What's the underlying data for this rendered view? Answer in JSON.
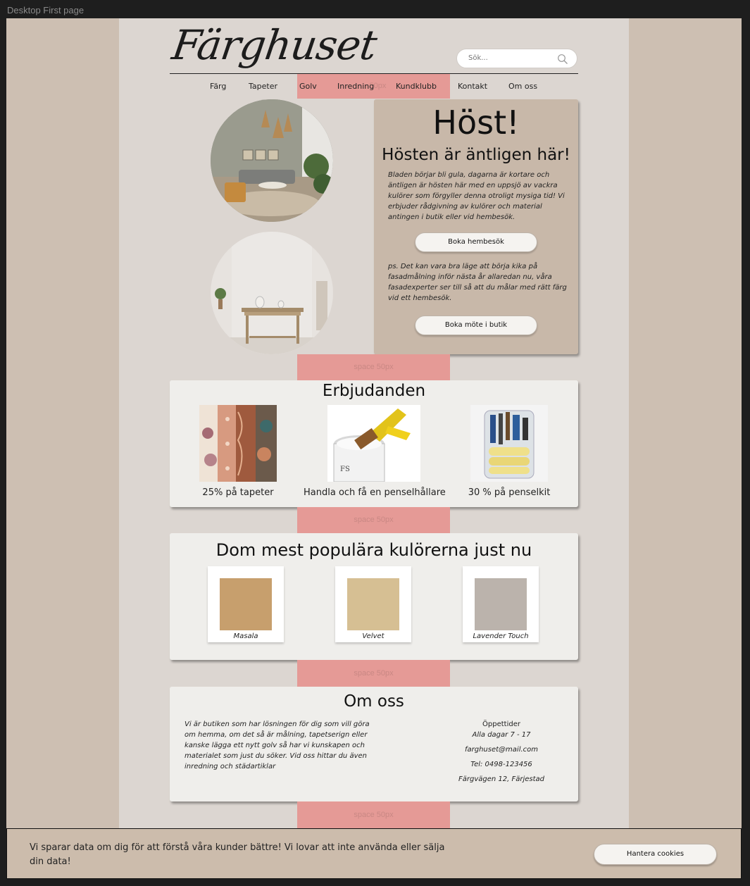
{
  "frame_label": "Desktop First page",
  "header": {
    "logo": "Färghuset",
    "search_placeholder": "Sök..."
  },
  "nav": {
    "items": [
      "Färg",
      "Tapeter",
      "Golv",
      "Inredning",
      "Kundklubb",
      "Kontakt",
      "Om oss"
    ],
    "spacer_label": "50px"
  },
  "hero": {
    "title": "Höst!",
    "subtitle": "Hösten är äntligen här!",
    "text1": "Bladen börjar bli gula, dagarna är kortare och äntligen är hösten här med en uppsjö av vackra kulörer som förgyller denna otroligt mysiga tid! Vi erbjuder rådgivning av kulörer och material antingen i butik eller vid hembesök.",
    "button1": "Boka hembesök",
    "text2": "ps. Det kan vara bra läge att börja kika på fasadmålning inför nästa år allaredan nu, våra fasadexperter ser till så att du målar med rätt färg vid ett hembesök.",
    "button2": "Boka möte i butik"
  },
  "spacer_label": "space 50px",
  "offers": {
    "title": "Erbjudanden",
    "items": [
      {
        "label": "25% på tapeter",
        "icon": "wallpaper-rolls-image"
      },
      {
        "label": "Handla och få en penselhållare",
        "icon": "paint-can-brush-image"
      },
      {
        "label": "30 % på penselkit",
        "icon": "brush-kit-image"
      }
    ]
  },
  "popular": {
    "title": "Dom mest populära kulörerna just nu",
    "swatches": [
      {
        "name": "Masala",
        "color": "#c79f6d"
      },
      {
        "name": "Velvet",
        "color": "#d6bf93"
      },
      {
        "name": "Lavender Touch",
        "color": "#bbb3ac"
      }
    ]
  },
  "about": {
    "title": "Om oss",
    "text": "Vi är butiken som har lösningen för dig som vill göra om hemma, om det så är målning, tapetserign eller kanske lägga ett nytt golv så har vi kunskapen och materialet som just du söker. Vid oss hittar du även inredning och städartiklar",
    "hours_label": "Öppettider",
    "hours": "Alla dagar 7 - 17",
    "email": "farghuset@mail.com",
    "phone": "Tel: 0498-123456",
    "address": "Färgvägen 12, Färjestad"
  },
  "cookie": {
    "text": "Vi sparar data om dig för att förstå våra kunder bättre! Vi lovar att inte använda eller sälja din data!",
    "button": "Hantera cookies"
  }
}
